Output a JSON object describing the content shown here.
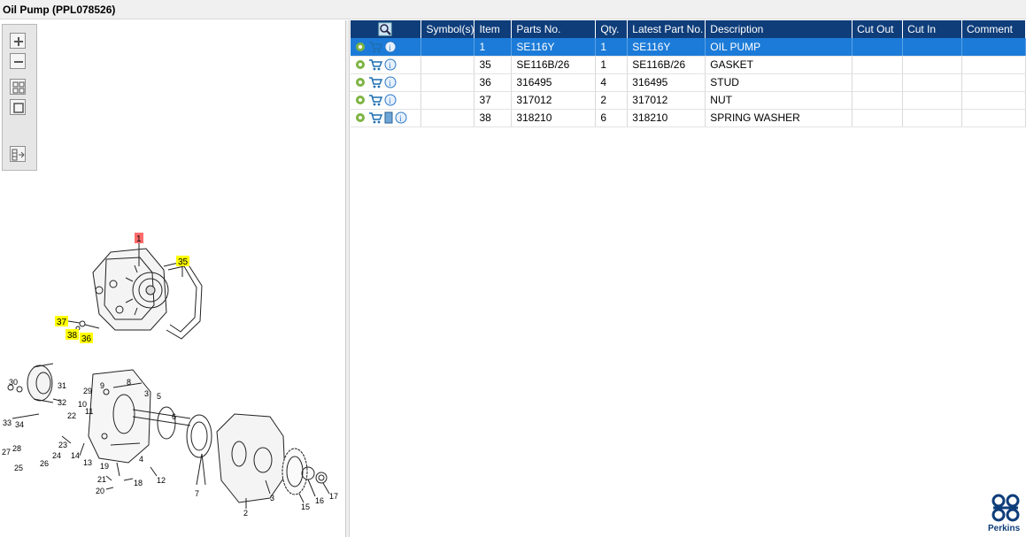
{
  "window": {
    "title": "Oil Pump (PPL078526)"
  },
  "viewer_toolbar": {
    "buttons": [
      "zoom-in",
      "zoom-out",
      "fit-all",
      "fit-window",
      "show-list"
    ]
  },
  "diagram": {
    "callouts_top": [
      "1",
      "35",
      "37",
      "38",
      "36"
    ],
    "callouts_bottom": [
      "30",
      "31",
      "29",
      "9",
      "8",
      "32",
      "10",
      "11",
      "5",
      "3",
      "33",
      "34",
      "22",
      "6",
      "28",
      "27",
      "23",
      "24",
      "14",
      "13",
      "25",
      "26",
      "19",
      "18",
      "21",
      "20",
      "12",
      "7",
      "3",
      "2",
      "16",
      "15",
      "17",
      "4"
    ]
  },
  "table": {
    "columns": [
      "",
      "Symbol(s)",
      "Item",
      "Parts No.",
      "Qty.",
      "Latest Part No.",
      "Description",
      "Cut Out",
      "Cut In",
      "Comment"
    ],
    "rows": [
      {
        "item": "1",
        "parts_no": "SE116Y",
        "qty": "1",
        "latest": "SE116Y",
        "description": "OIL PUMP",
        "selected": true,
        "doc": false
      },
      {
        "item": "35",
        "parts_no": "SE116B/26",
        "qty": "1",
        "latest": "SE116B/26",
        "description": "GASKET",
        "selected": false,
        "doc": false
      },
      {
        "item": "36",
        "parts_no": "316495",
        "qty": "4",
        "latest": "316495",
        "description": "STUD",
        "selected": false,
        "doc": false
      },
      {
        "item": "37",
        "parts_no": "317012",
        "qty": "2",
        "latest": "317012",
        "description": "NUT",
        "selected": false,
        "doc": false
      },
      {
        "item": "38",
        "parts_no": "318210",
        "qty": "6",
        "latest": "318210",
        "description": "SPRING WASHER",
        "selected": false,
        "doc": true
      }
    ]
  },
  "colors": {
    "header": "#0e3d7a",
    "selected": "#1c7bd8",
    "highlight_yellow": "#ffff00",
    "highlight_red": "#ff6b6b"
  },
  "logo": {
    "brand": "Perkins"
  }
}
